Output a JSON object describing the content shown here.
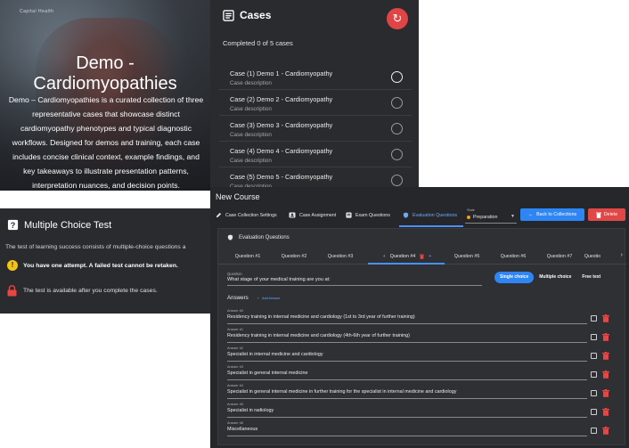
{
  "hero": {
    "tagline": "Capital Health",
    "title_line1": "Demo -",
    "title_line2": "Cardiomyopathies",
    "description": "Demo – Cardiomyopathies is a curated collection of three representative cases that showcase distinct cardiomyopathy phenotypes and typical diagnostic workflows. Designed for demos and training, each case includes concise clinical context, example findings, and key takeaways to illustrate presentation patterns, interpretation nuances, and decision points."
  },
  "cases": {
    "title": "Cases",
    "completed": "Completed 0 of 5 cases",
    "items": [
      {
        "title": "Case (1) Demo 1 - Cardiomyopathy",
        "desc": "Case description"
      },
      {
        "title": "Case (2) Demo 2 - Cardiomyopathy",
        "desc": "Case description"
      },
      {
        "title": "Case (3) Demo 3 - Cardiomyopathy",
        "desc": "Case description"
      },
      {
        "title": "Case (4) Demo 4 - Cardiomyopathy",
        "desc": "Case description"
      },
      {
        "title": "Case (5) Demo 5 - Cardiomyopathy",
        "desc": "Case description"
      }
    ]
  },
  "test": {
    "title": "Multiple Choice Test",
    "description": "The test of learning success consists of multiple-choice questions a",
    "warning": "You have one attempt. A failed test cannot be retaken.",
    "lock_note": "The test is available after you complete the cases."
  },
  "editor": {
    "title": "New Course",
    "tabs": {
      "collection_settings": "Case Collection Settings",
      "assignment": "Case Assignment",
      "exam": "Exam Questions",
      "evaluation": "Evaluation Questions"
    },
    "state_label": "State",
    "state_value": "Preparation",
    "back_label": "Back to Collections",
    "delete_label": "Delete",
    "section_title": "Evaluation Questions",
    "question_tabs": [
      "Question #1",
      "Question #2",
      "Question #3",
      "Question #4",
      "Question #5",
      "Question #6",
      "Question #7",
      "Questio"
    ],
    "question_label": "Question",
    "question_text": "What stage of your medical training are you at:",
    "modes": [
      "Single choice",
      "Multiple choice",
      "Free text"
    ],
    "answers_title": "Answers",
    "add_answer": "Add Answer",
    "answers": [
      {
        "label": "Answer #0",
        "text": "Residency training in internal medicine and cardiology (1st to 3rd year of further training)"
      },
      {
        "label": "Answer #1",
        "text": "Residency training in internal medicine and cardiology (4th-6th year of further training)"
      },
      {
        "label": "Answer #2",
        "text": "Specialist in internal medicine and cardiology"
      },
      {
        "label": "Answer #3",
        "text": "Specialist in general internal medicine"
      },
      {
        "label": "Answer #4",
        "text": "Specialist in general internal medicine in further training for the specialist in internal medicine and cardiology"
      },
      {
        "label": "Answer #5",
        "text": "Specialist in radiology"
      },
      {
        "label": "Answer #6",
        "text": "Miscellaneous"
      }
    ]
  },
  "colors": {
    "accent": "#2e86f5",
    "danger": "#e04848",
    "warning": "#f2c318",
    "panel": "#2a2b2e"
  }
}
